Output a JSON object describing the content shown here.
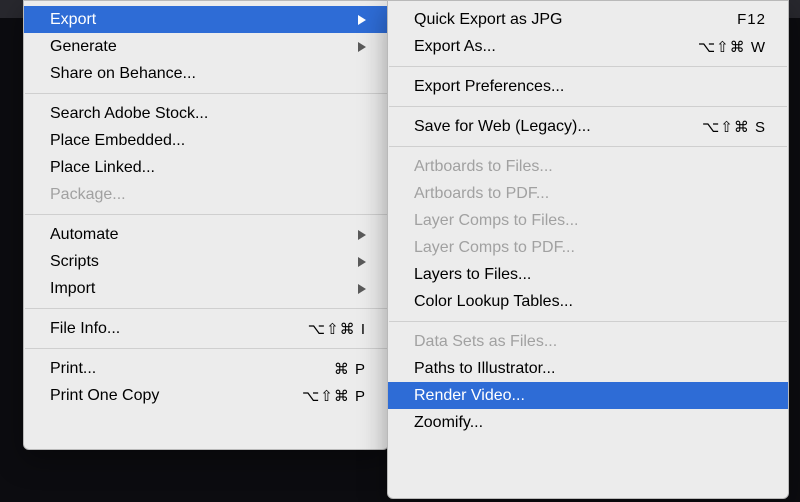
{
  "main_menu": {
    "groups": [
      [
        {
          "id": "export",
          "label": "Export",
          "submenu": true,
          "hl": true
        },
        {
          "id": "generate",
          "label": "Generate",
          "submenu": true
        },
        {
          "id": "share-behance",
          "label": "Share on Behance..."
        }
      ],
      [
        {
          "id": "search-adobe-stock",
          "label": "Search Adobe Stock..."
        },
        {
          "id": "place-embedded",
          "label": "Place Embedded..."
        },
        {
          "id": "place-linked",
          "label": "Place Linked..."
        },
        {
          "id": "package",
          "label": "Package...",
          "disabled": true
        }
      ],
      [
        {
          "id": "automate",
          "label": "Automate",
          "submenu": true
        },
        {
          "id": "scripts",
          "label": "Scripts",
          "submenu": true
        },
        {
          "id": "import",
          "label": "Import",
          "submenu": true
        }
      ],
      [
        {
          "id": "file-info",
          "label": "File Info...",
          "shortcut": "⌥⇧⌘ I"
        }
      ],
      [
        {
          "id": "print",
          "label": "Print...",
          "shortcut": "⌘ P"
        },
        {
          "id": "print-one-copy",
          "label": "Print One Copy",
          "shortcut": "⌥⇧⌘ P"
        }
      ]
    ]
  },
  "sub_menu": {
    "groups": [
      [
        {
          "id": "quick-export-jpg",
          "label": "Quick Export as JPG",
          "shortcut": "F12"
        },
        {
          "id": "export-as",
          "label": "Export As...",
          "shortcut": "⌥⇧⌘ W"
        }
      ],
      [
        {
          "id": "export-preferences",
          "label": "Export Preferences..."
        }
      ],
      [
        {
          "id": "save-for-web",
          "label": "Save for Web (Legacy)...",
          "shortcut": "⌥⇧⌘ S"
        }
      ],
      [
        {
          "id": "artboards-to-files",
          "label": "Artboards to Files...",
          "disabled": true
        },
        {
          "id": "artboards-to-pdf",
          "label": "Artboards to PDF...",
          "disabled": true
        },
        {
          "id": "layer-comps-to-files",
          "label": "Layer Comps to Files...",
          "disabled": true
        },
        {
          "id": "layer-comps-to-pdf",
          "label": "Layer Comps to PDF...",
          "disabled": true
        },
        {
          "id": "layers-to-files",
          "label": "Layers to Files..."
        },
        {
          "id": "color-lookup-tables",
          "label": "Color Lookup Tables..."
        }
      ],
      [
        {
          "id": "data-sets-as-files",
          "label": "Data Sets as Files...",
          "disabled": true
        },
        {
          "id": "paths-to-illustrator",
          "label": "Paths to Illustrator..."
        },
        {
          "id": "render-video",
          "label": "Render Video...",
          "hl": true
        },
        {
          "id": "zoomify",
          "label": "Zoomify..."
        }
      ]
    ]
  }
}
